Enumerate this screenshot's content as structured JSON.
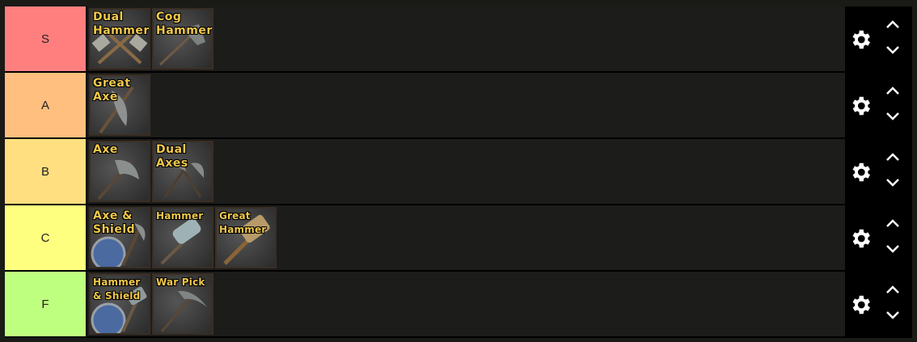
{
  "tiers": [
    {
      "label": "S",
      "color": "#ff7f7f",
      "items": [
        {
          "name": "Dual Hammers",
          "icon": "dual-hammers-icon"
        },
        {
          "name": "Cog Hammer",
          "icon": "cog-hammer-icon"
        }
      ]
    },
    {
      "label": "A",
      "color": "#ffbf7f",
      "items": [
        {
          "name": "Great Axe",
          "icon": "great-axe-icon"
        }
      ]
    },
    {
      "label": "B",
      "color": "#ffdf7f",
      "items": [
        {
          "name": "Axe",
          "icon": "axe-icon"
        },
        {
          "name": "Dual Axes",
          "icon": "dual-axes-icon"
        }
      ]
    },
    {
      "label": "C",
      "color": "#ffff7f",
      "items": [
        {
          "name": "Axe & Shield",
          "icon": "axe-shield-icon"
        },
        {
          "name": "Hammer",
          "icon": "hammer-icon"
        },
        {
          "name": "Great Hammer",
          "icon": "great-hammer-icon"
        }
      ]
    },
    {
      "label": "F",
      "color": "#bfff7f",
      "items": [
        {
          "name": "Hammer & Shield",
          "icon": "hammer-shield-icon"
        },
        {
          "name": "War Pick",
          "icon": "war-pick-icon"
        }
      ]
    }
  ],
  "controls": {
    "settings_icon": "gear-icon",
    "move_up_icon": "chevron-up-icon",
    "move_down_icon": "chevron-down-icon"
  }
}
